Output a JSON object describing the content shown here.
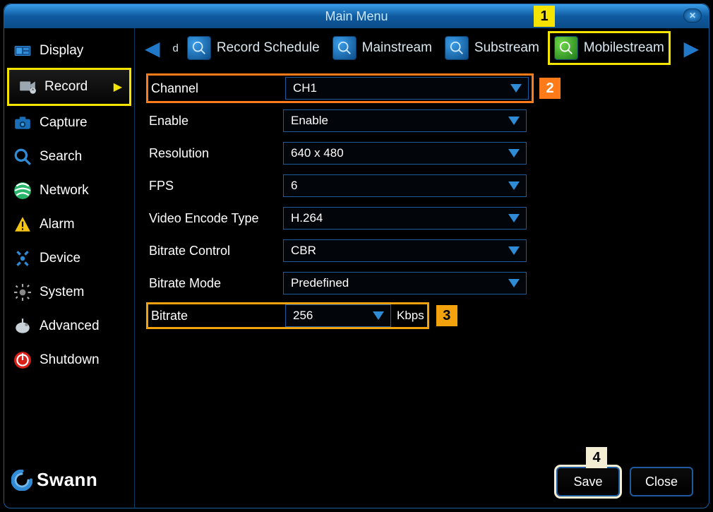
{
  "window": {
    "title": "Main Menu"
  },
  "sidebar": {
    "items": [
      {
        "label": "Display",
        "icon": "display-icon"
      },
      {
        "label": "Record",
        "icon": "record-icon"
      },
      {
        "label": "Capture",
        "icon": "capture-icon"
      },
      {
        "label": "Search",
        "icon": "search-icon"
      },
      {
        "label": "Network",
        "icon": "network-icon"
      },
      {
        "label": "Alarm",
        "icon": "alarm-icon"
      },
      {
        "label": "Device",
        "icon": "device-icon"
      },
      {
        "label": "System",
        "icon": "system-icon"
      },
      {
        "label": "Advanced",
        "icon": "advanced-icon"
      },
      {
        "label": "Shutdown",
        "icon": "shutdown-icon"
      }
    ],
    "active_index": 1,
    "brand": "Swann"
  },
  "tabs": {
    "truncated_prefix": "d",
    "items": [
      {
        "label": "Record Schedule"
      },
      {
        "label": "Mainstream"
      },
      {
        "label": "Substream"
      },
      {
        "label": "Mobilestream"
      }
    ],
    "highlight_index": 3
  },
  "form": {
    "rows": [
      {
        "label": "Channel",
        "value": "CH1"
      },
      {
        "label": "Enable",
        "value": "Enable"
      },
      {
        "label": "Resolution",
        "value": "640 x 480"
      },
      {
        "label": "FPS",
        "value": "6"
      },
      {
        "label": "Video Encode Type",
        "value": "H.264"
      },
      {
        "label": "Bitrate Control",
        "value": "CBR"
      },
      {
        "label": "Bitrate Mode",
        "value": "Predefined"
      },
      {
        "label": "Bitrate",
        "value": "256",
        "unit": "Kbps"
      }
    ]
  },
  "callouts": {
    "1": "1",
    "2": "2",
    "3": "3",
    "4": "4"
  },
  "footer": {
    "save": "Save",
    "close": "Close"
  },
  "colors": {
    "highlight_yellow": "#f5e400",
    "highlight_orange": "#ff7b1a",
    "highlight_amber": "#f2a20c",
    "accent_blue": "#1d5a9e"
  }
}
